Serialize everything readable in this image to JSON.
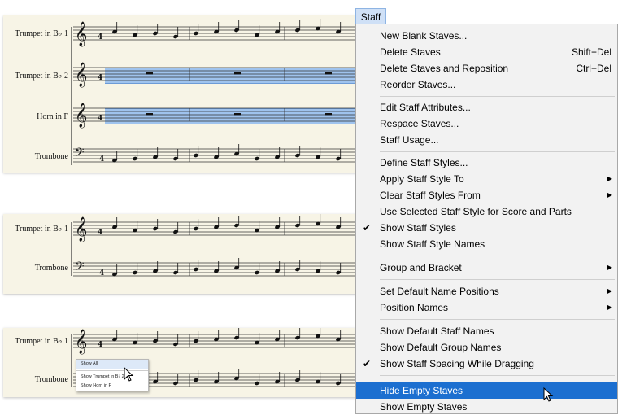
{
  "score": {
    "panel1_staves": [
      "Trumpet in B♭ 1",
      "Trumpet in B♭ 2",
      "Horn in F",
      "Trombone"
    ],
    "panel2_staves": [
      "Trumpet in B♭ 1",
      "Trombone"
    ],
    "panel3_staves": [
      "Trumpet in B♭ 1",
      "Trombone"
    ]
  },
  "context_menu": {
    "items": [
      "Show All",
      "Show Trumpet in B♭ 2",
      "Show Horn in F"
    ]
  },
  "staff_menu": {
    "title": "Staff",
    "items": [
      {
        "label": "New Blank Staves...",
        "shortcut": "",
        "submenu": false,
        "checked": false
      },
      {
        "label": "Delete Staves",
        "shortcut": "Shift+Del",
        "submenu": false,
        "checked": false
      },
      {
        "label": "Delete Staves and Reposition",
        "shortcut": "Ctrl+Del",
        "submenu": false,
        "checked": false
      },
      {
        "label": "Reorder Staves...",
        "shortcut": "",
        "submenu": false,
        "checked": false
      },
      {
        "label": "Edit Staff Attributes...",
        "shortcut": "",
        "submenu": false,
        "checked": false
      },
      {
        "label": "Respace Staves...",
        "shortcut": "",
        "submenu": false,
        "checked": false
      },
      {
        "label": "Staff Usage...",
        "shortcut": "",
        "submenu": false,
        "checked": false
      },
      {
        "label": "Define Staff Styles...",
        "shortcut": "",
        "submenu": false,
        "checked": false
      },
      {
        "label": "Apply Staff Style To",
        "shortcut": "",
        "submenu": true,
        "checked": false
      },
      {
        "label": "Clear Staff Styles From",
        "shortcut": "",
        "submenu": true,
        "checked": false
      },
      {
        "label": "Use Selected Staff Style for Score and Parts",
        "shortcut": "",
        "submenu": false,
        "checked": false
      },
      {
        "label": "Show Staff Styles",
        "shortcut": "",
        "submenu": false,
        "checked": true
      },
      {
        "label": "Show Staff Style Names",
        "shortcut": "",
        "submenu": false,
        "checked": false
      },
      {
        "label": "Group and Bracket",
        "shortcut": "",
        "submenu": true,
        "checked": false
      },
      {
        "label": "Set Default Name Positions",
        "shortcut": "",
        "submenu": true,
        "checked": false
      },
      {
        "label": "Position Names",
        "shortcut": "",
        "submenu": true,
        "checked": false
      },
      {
        "label": "Show Default Staff Names",
        "shortcut": "",
        "submenu": false,
        "checked": false
      },
      {
        "label": "Show Default Group Names",
        "shortcut": "",
        "submenu": false,
        "checked": false
      },
      {
        "label": "Show Staff Spacing While Dragging",
        "shortcut": "",
        "submenu": false,
        "checked": true
      },
      {
        "label": "Hide Empty Staves",
        "shortcut": "",
        "submenu": false,
        "checked": false,
        "highlighted": true
      },
      {
        "label": "Show Empty Staves",
        "shortcut": "",
        "submenu": false,
        "checked": false
      }
    ]
  },
  "colors": {
    "accent": "#1c6fd0",
    "selection": "#9fc3ee",
    "paper": "#f7f4e6"
  }
}
